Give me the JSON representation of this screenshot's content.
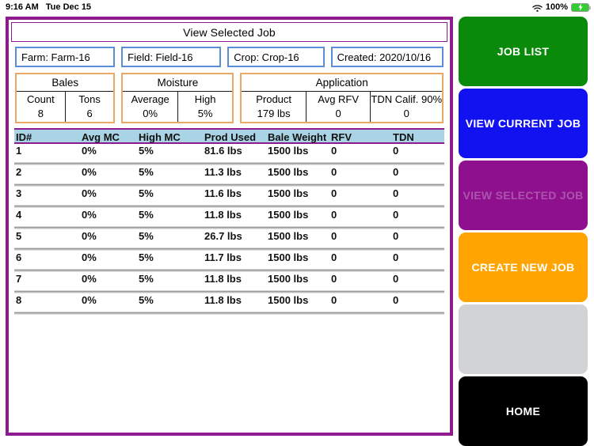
{
  "statusbar": {
    "time": "9:16 AM",
    "date": "Tue Dec 15",
    "wifi_icon": "wifi-icon",
    "battery_percent": "100%",
    "battery_icon": "battery-charging-icon"
  },
  "panel": {
    "title": "View Selected Job",
    "border_color": "#8e1a8e"
  },
  "meta": [
    {
      "name": "farm-field",
      "text": "Farm: Farm-16"
    },
    {
      "name": "field-field",
      "text": "Field: Field-16"
    },
    {
      "name": "crop-field",
      "text": "Crop: Crop-16"
    },
    {
      "name": "created-field",
      "text": "Created: 2020/10/16"
    }
  ],
  "groups": [
    {
      "title": "Bales",
      "cells": [
        {
          "label": "Count",
          "value": "8"
        },
        {
          "label": "Tons",
          "value": "6"
        }
      ]
    },
    {
      "title": "Moisture",
      "cells": [
        {
          "label": "Average",
          "value": "0%"
        },
        {
          "label": "High",
          "value": "5%"
        }
      ]
    },
    {
      "title": "Application",
      "cells": [
        {
          "label": "Product",
          "value": "179 lbs"
        },
        {
          "label": "Avg RFV",
          "value": "0"
        },
        {
          "label": "TDN Calif. 90%",
          "value": "0"
        }
      ]
    }
  ],
  "table": {
    "columns": [
      "ID#",
      "Avg MC",
      "High MC",
      "Prod Used",
      "Bale Weight",
      "RFV",
      "TDN"
    ],
    "header_bg": "#a9d4e6",
    "rows": [
      {
        "id": "1",
        "avg_mc": "0%",
        "high_mc": "5%",
        "prod_used": "81.6 lbs",
        "bale_weight": "1500 lbs",
        "rfv": "0",
        "tdn": "0"
      },
      {
        "id": "2",
        "avg_mc": "0%",
        "high_mc": "5%",
        "prod_used": "11.3 lbs",
        "bale_weight": "1500 lbs",
        "rfv": "0",
        "tdn": "0"
      },
      {
        "id": "3",
        "avg_mc": "0%",
        "high_mc": "5%",
        "prod_used": "11.6 lbs",
        "bale_weight": "1500 lbs",
        "rfv": "0",
        "tdn": "0"
      },
      {
        "id": "4",
        "avg_mc": "0%",
        "high_mc": "5%",
        "prod_used": "11.8 lbs",
        "bale_weight": "1500 lbs",
        "rfv": "0",
        "tdn": "0"
      },
      {
        "id": "5",
        "avg_mc": "0%",
        "high_mc": "5%",
        "prod_used": "26.7 lbs",
        "bale_weight": "1500 lbs",
        "rfv": "0",
        "tdn": "0"
      },
      {
        "id": "6",
        "avg_mc": "0%",
        "high_mc": "5%",
        "prod_used": "11.7 lbs",
        "bale_weight": "1500 lbs",
        "rfv": "0",
        "tdn": "0"
      },
      {
        "id": "7",
        "avg_mc": "0%",
        "high_mc": "5%",
        "prod_used": "11.8 lbs",
        "bale_weight": "1500 lbs",
        "rfv": "0",
        "tdn": "0"
      },
      {
        "id": "8",
        "avg_mc": "0%",
        "high_mc": "5%",
        "prod_used": "11.8 lbs",
        "bale_weight": "1500 lbs",
        "rfv": "0",
        "tdn": "0"
      }
    ]
  },
  "sidebar": {
    "buttons": [
      {
        "name": "job-list",
        "label": "JOB LIST",
        "color": "#0a8a0a"
      },
      {
        "name": "view-current-job",
        "label": "VIEW CURRENT JOB",
        "color": "#1212f0"
      },
      {
        "name": "view-selected-job",
        "label": "VIEW SELECTED JOB",
        "color": "#8e108e",
        "state": "dimmed"
      },
      {
        "name": "create-new-job",
        "label": "CREATE NEW JOB",
        "color": "#ffa401"
      },
      {
        "name": "blank",
        "label": "",
        "color": "#d2d3d5"
      },
      {
        "name": "home",
        "label": "HOME",
        "color": "#000000"
      }
    ]
  }
}
